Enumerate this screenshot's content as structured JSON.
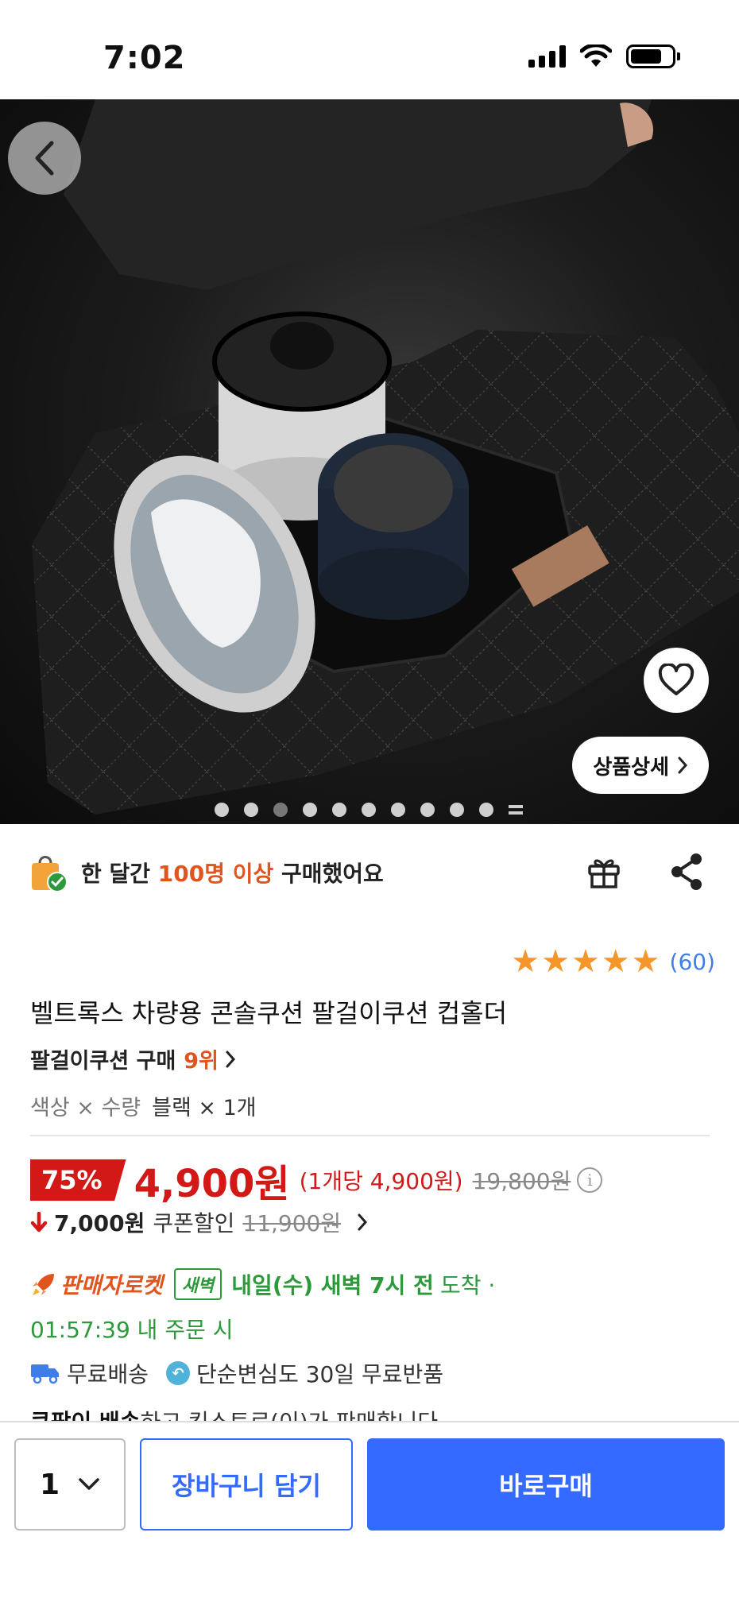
{
  "status_bar": {
    "time": "7:02"
  },
  "hero": {
    "detail_button_label": "상품상세",
    "dots_total": 10,
    "active_dot": 2
  },
  "purchase_info": {
    "prefix": "한 달간 ",
    "highlight": "100명 이상",
    "suffix": " 구매했어요"
  },
  "rating": {
    "stars": 5,
    "count": "(60)"
  },
  "product": {
    "title": "벨트록스 차량용 콘솔쿠션 팔걸이쿠션 컵홀더",
    "rank_category": "팔걸이쿠션 구매",
    "rank_number": "9위",
    "option_label": "색상 × 수량",
    "option_value": "블랙 × 1개"
  },
  "price": {
    "discount": "75%",
    "sale_price": "4,900원",
    "unit_price": "(1개당 4,900원)",
    "original_price": "19,800원"
  },
  "coupon": {
    "amount": "7,000원",
    "label": "쿠폰할인",
    "before_price": "11,900원"
  },
  "delivery": {
    "type": "판매자로켓",
    "badge": "새벽",
    "arrival_bold": "내일(수) 새벽 7시 전",
    "arrival_suffix": "도착 ·",
    "deadline": "01:57:39 내 주문 시"
  },
  "shipping": {
    "free_delivery": "무료배송",
    "free_return": "단순변심도 30일 무료반품"
  },
  "seller": {
    "bold": "쿠팡이 배송",
    "rest": "하고 킨스토르(이)가 판매합니다"
  },
  "bottom_bar": {
    "quantity": "1",
    "cart_label": "장바구니 담기",
    "buy_label": "바로구매"
  },
  "colors": {
    "accent_blue": "#346aff",
    "sale_red": "#d31818",
    "highlight_orange": "#e0541e",
    "delivery_green": "#2c9a3a",
    "star_orange": "#f5962a"
  }
}
